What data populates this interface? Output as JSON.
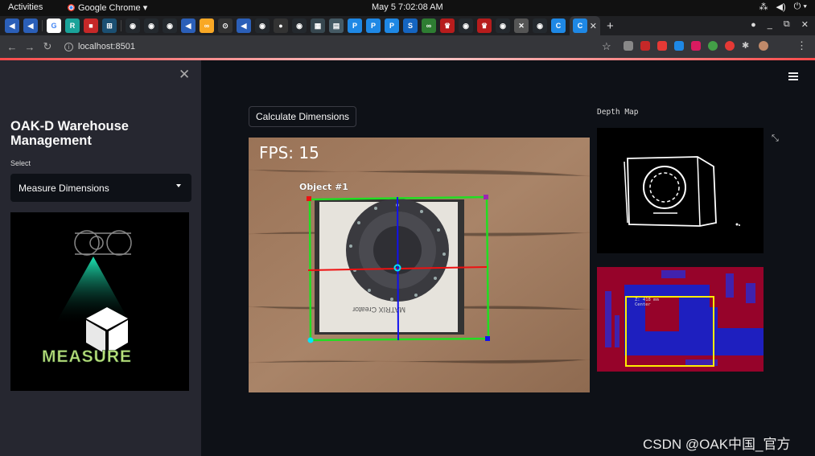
{
  "topbar": {
    "activities": "Activities",
    "app_name": "Google Chrome ▾",
    "clock": "May 5  7:02:08 AM"
  },
  "browser": {
    "url": "localhost:8501"
  },
  "sidebar": {
    "title": "OAK-D Warehouse Management",
    "select_label": "Select",
    "select_value": "Measure Dimensions",
    "logo_text": "MEASURE"
  },
  "main": {
    "calculate_button": "Calculate Dimensions",
    "depth_map_label": "Depth Map",
    "camera": {
      "fps_label": "FPS: 15",
      "object_label": "Object #1"
    },
    "heatmap_text": {
      "line1": "Z: 418 mm",
      "line2": "Center"
    }
  },
  "watermark": "CSDN @OAK中国_官方",
  "colors": {
    "sidebar_bg": "#262730",
    "main_bg": "#0e1117",
    "bbox_green": "#22dd22",
    "axis_red": "#ee1111",
    "axis_blue": "#1111ee",
    "heat_blue": "#2222cc",
    "heat_red": "#aa0000",
    "heat_box": "#ffee00"
  }
}
